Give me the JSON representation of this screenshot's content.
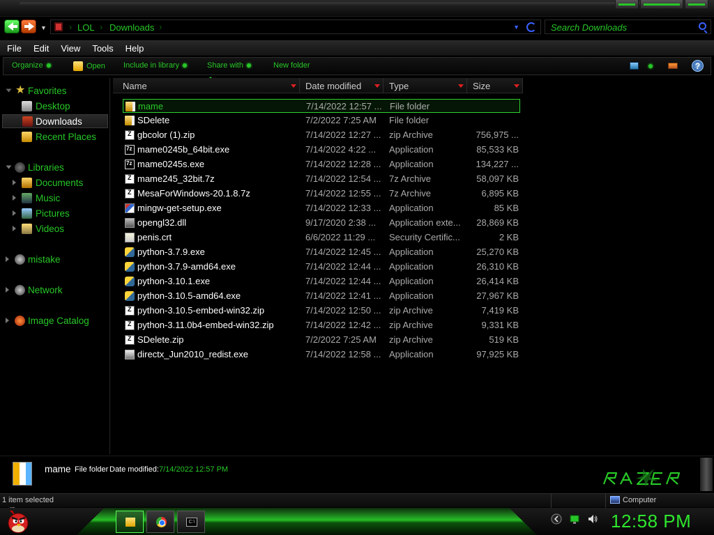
{
  "address": {
    "crumbs": [
      "LOL",
      "Downloads"
    ],
    "search_placeholder": "Search Downloads"
  },
  "menu": [
    "File",
    "Edit",
    "View",
    "Tools",
    "Help"
  ],
  "commands": {
    "organize": "Organize",
    "open": "Open",
    "include_in_library": "Include in library",
    "share_with": "Share with",
    "new_folder": "New folder"
  },
  "nav": {
    "favorites": "Favorites",
    "desktop": "Desktop",
    "downloads": "Downloads",
    "recent_places": "Recent Places",
    "libraries": "Libraries",
    "documents": "Documents",
    "music": "Music",
    "pictures": "Pictures",
    "videos": "Videos",
    "user": "mistake",
    "network": "Network",
    "image_catalog": "Image Catalog"
  },
  "columns": {
    "name": "Name",
    "date": "Date modified",
    "type": "Type",
    "size": "Size"
  },
  "files": [
    {
      "name": "mame",
      "date": "7/14/2022 12:57 ...",
      "type": "File folder",
      "size": "",
      "icon": "folder-icon"
    },
    {
      "name": "SDelete",
      "date": "7/2/2022 7:25 AM",
      "type": "File folder",
      "size": "",
      "icon": "folder-icon"
    },
    {
      "name": "gbcolor (1).zip",
      "date": "7/14/2022 12:27 ...",
      "type": "zip Archive",
      "size": "756,975 ...",
      "icon": "zip-archive-icon"
    },
    {
      "name": "mame0245b_64bit.exe",
      "date": "7/14/2022 4:22 ...",
      "type": "Application",
      "size": "85,533 KB",
      "icon": "7z-icon"
    },
    {
      "name": "mame0245s.exe",
      "date": "7/14/2022 12:28 ...",
      "type": "Application",
      "size": "134,227 ...",
      "icon": "7z-icon"
    },
    {
      "name": "mame245_32bit.7z",
      "date": "7/14/2022 12:54 ...",
      "type": "7z Archive",
      "size": "58,097 KB",
      "icon": "zip-archive-icon"
    },
    {
      "name": "MesaForWindows-20.1.8.7z",
      "date": "7/14/2022 12:55 ...",
      "type": "7z Archive",
      "size": "6,895 KB",
      "icon": "zip-archive-icon"
    },
    {
      "name": "mingw-get-setup.exe",
      "date": "7/14/2022 12:33 ...",
      "type": "Application",
      "size": "85 KB",
      "icon": "installer-icon"
    },
    {
      "name": "opengl32.dll",
      "date": "9/17/2020 2:38 ...",
      "type": "Application exte...",
      "size": "28,869 KB",
      "icon": "dll-icon"
    },
    {
      "name": "penis.crt",
      "date": "6/6/2022 11:29 ...",
      "type": "Security Certific...",
      "size": "2 KB",
      "icon": "certificate-icon"
    },
    {
      "name": "python-3.7.9.exe",
      "date": "7/14/2022 12:45 ...",
      "type": "Application",
      "size": "25,270 KB",
      "icon": "python-icon"
    },
    {
      "name": "python-3.7.9-amd64.exe",
      "date": "7/14/2022 12:44 ...",
      "type": "Application",
      "size": "26,310 KB",
      "icon": "python-icon"
    },
    {
      "name": "python-3.10.1.exe",
      "date": "7/14/2022 12:44 ...",
      "type": "Application",
      "size": "26,414 KB",
      "icon": "python-icon"
    },
    {
      "name": "python-3.10.5-amd64.exe",
      "date": "7/14/2022 12:41 ...",
      "type": "Application",
      "size": "27,967 KB",
      "icon": "python-icon"
    },
    {
      "name": "python-3.10.5-embed-win32.zip",
      "date": "7/14/2022 12:50 ...",
      "type": "zip Archive",
      "size": "7,419 KB",
      "icon": "zip-archive-icon"
    },
    {
      "name": "python-3.11.0b4-embed-win32.zip",
      "date": "7/14/2022 12:42 ...",
      "type": "zip Archive",
      "size": "9,331 KB",
      "icon": "zip-archive-icon"
    },
    {
      "name": "SDelete.zip",
      "date": "7/2/2022 7:25 AM",
      "type": "zip Archive",
      "size": "519 KB",
      "icon": "zip-archive-icon"
    },
    {
      "name": "directx_Jun2010_redist.exe",
      "date": "7/14/2022 12:58 ...",
      "type": "Application",
      "size": "97,925 KB",
      "icon": "directx-icon"
    }
  ],
  "details": {
    "name": "mame",
    "type": "File folder",
    "date_label": "Date modified:",
    "date_value": "7/14/2022 12:57 PM"
  },
  "status": {
    "selection": "1 item selected",
    "location": "Computer"
  },
  "clock": "12:58 PM",
  "colors": {
    "accent": "#27c627",
    "selection_border": "#2ed12e",
    "background": "#000000",
    "sort_arrow": "#e02020"
  }
}
